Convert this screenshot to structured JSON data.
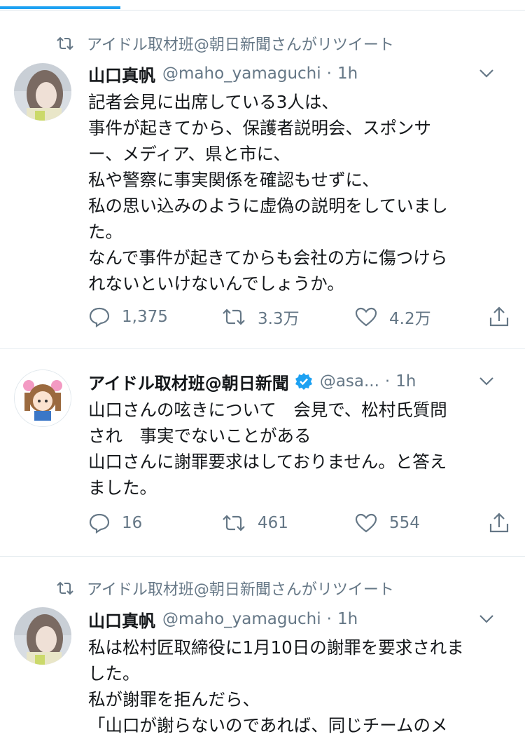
{
  "tabs": {
    "active_index": 0
  },
  "tweets": [
    {
      "retweet_by": "アイドル取材班@朝日新聞さんがリツイート",
      "name": "山口真帆",
      "handle": "@maho_yamaguchi",
      "dot": "·",
      "time": "1h",
      "lines": [
        "記者会見に出席している3人は、",
        "事件が起きてから、保護者説明会、スポンサ",
        "ー、メディア、県と市に、",
        "私や警察に事実関係を確認もせずに、",
        "私の思い込みのように虚偽の説明をしていまし",
        "た。",
        "なんで事件が起きてからも会社の方に傷つけら",
        "れないといけないんでしょうか。"
      ],
      "replies": "1,375",
      "retweets": "3.3万",
      "likes": "4.2万"
    },
    {
      "name": "アイドル取材班@朝日新聞",
      "verified": true,
      "handle": "@asa...",
      "dot": "·",
      "time": "1h",
      "lines": [
        "山口さんの呟きについて　会見で、松村氏質問",
        "され　事実でないことがある",
        "山口さんに謝罪要求はしておりません。と答え",
        "ました。"
      ],
      "replies": "16",
      "retweets": "461",
      "likes": "554"
    },
    {
      "retweet_by": "アイドル取材班@朝日新聞さんがリツイート",
      "name": "山口真帆",
      "handle": "@maho_yamaguchi",
      "dot": "·",
      "time": "1h",
      "lines": [
        "私は松村匠取締役に1月10日の謝罪を要求されま",
        "した。",
        "私が謝罪を拒んだら、",
        "「山口が謝らないのであれば、同じチームのメ"
      ]
    }
  ],
  "colors": {
    "accent": "#1da1f2",
    "secondary_text": "#657786",
    "divider": "#e6ecf0"
  }
}
